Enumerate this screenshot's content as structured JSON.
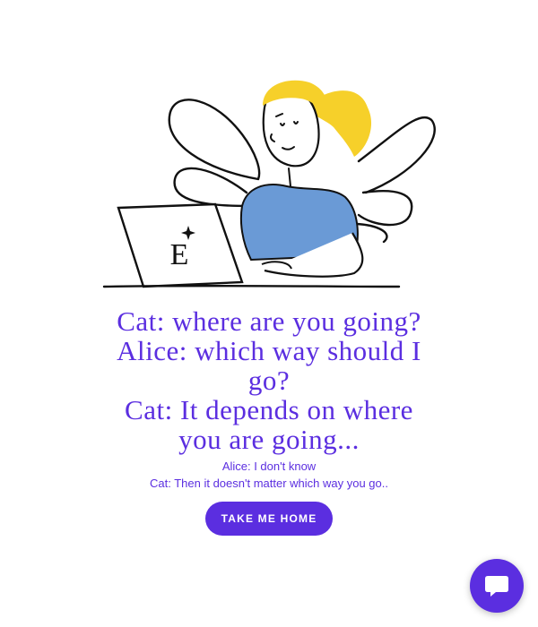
{
  "colors": {
    "accent": "#5b2ee0",
    "shirt": "#6a9ad6",
    "hair": "#f6d02a",
    "ink": "#111111",
    "background": "#ffffff"
  },
  "illustration": {
    "icon": "girl-with-laptop-illustration",
    "laptop_logo": "E"
  },
  "heading_lines": [
    "Cat: where are you going?",
    "Alice: which way should I",
    "go?",
    "Cat: It depends on where",
    "you are going..."
  ],
  "dialog": {
    "line1": "Alice: I don't know",
    "line2": "Cat: Then it doesn't matter which way you go.."
  },
  "button": {
    "label": "TAKE ME HOME"
  },
  "chat": {
    "icon": "chat-bubble-icon"
  }
}
